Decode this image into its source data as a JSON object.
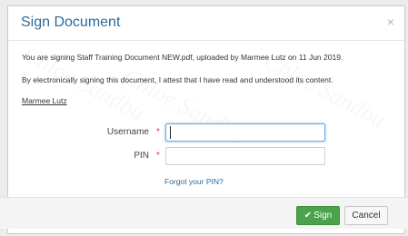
{
  "dialog": {
    "title": "Sign Document",
    "close_glyph": "×",
    "message_line1": "You are signing Staff Training Document NEW.pdf, uploaded by Marmee Lutz on 11 Jun 2019.",
    "message_line2": "By electronically signing this document, I attest that I have read and understood its content.",
    "signer_name": "Marmee Lutz",
    "watermark_text": "Chloe Sandbu"
  },
  "form": {
    "username_label": "Username",
    "pin_label": "PIN",
    "required_marker": "*",
    "username_value": "",
    "pin_value": "",
    "forgot_pin_link": "Forgot your PIN?"
  },
  "footer": {
    "sign_label": "Sign",
    "sign_icon": "check-icon",
    "cancel_label": "Cancel"
  },
  "colors": {
    "title": "#2d6b9c",
    "sign_button": "#4aa34a",
    "required": "#e04040",
    "focus_border": "#66a9e0"
  }
}
